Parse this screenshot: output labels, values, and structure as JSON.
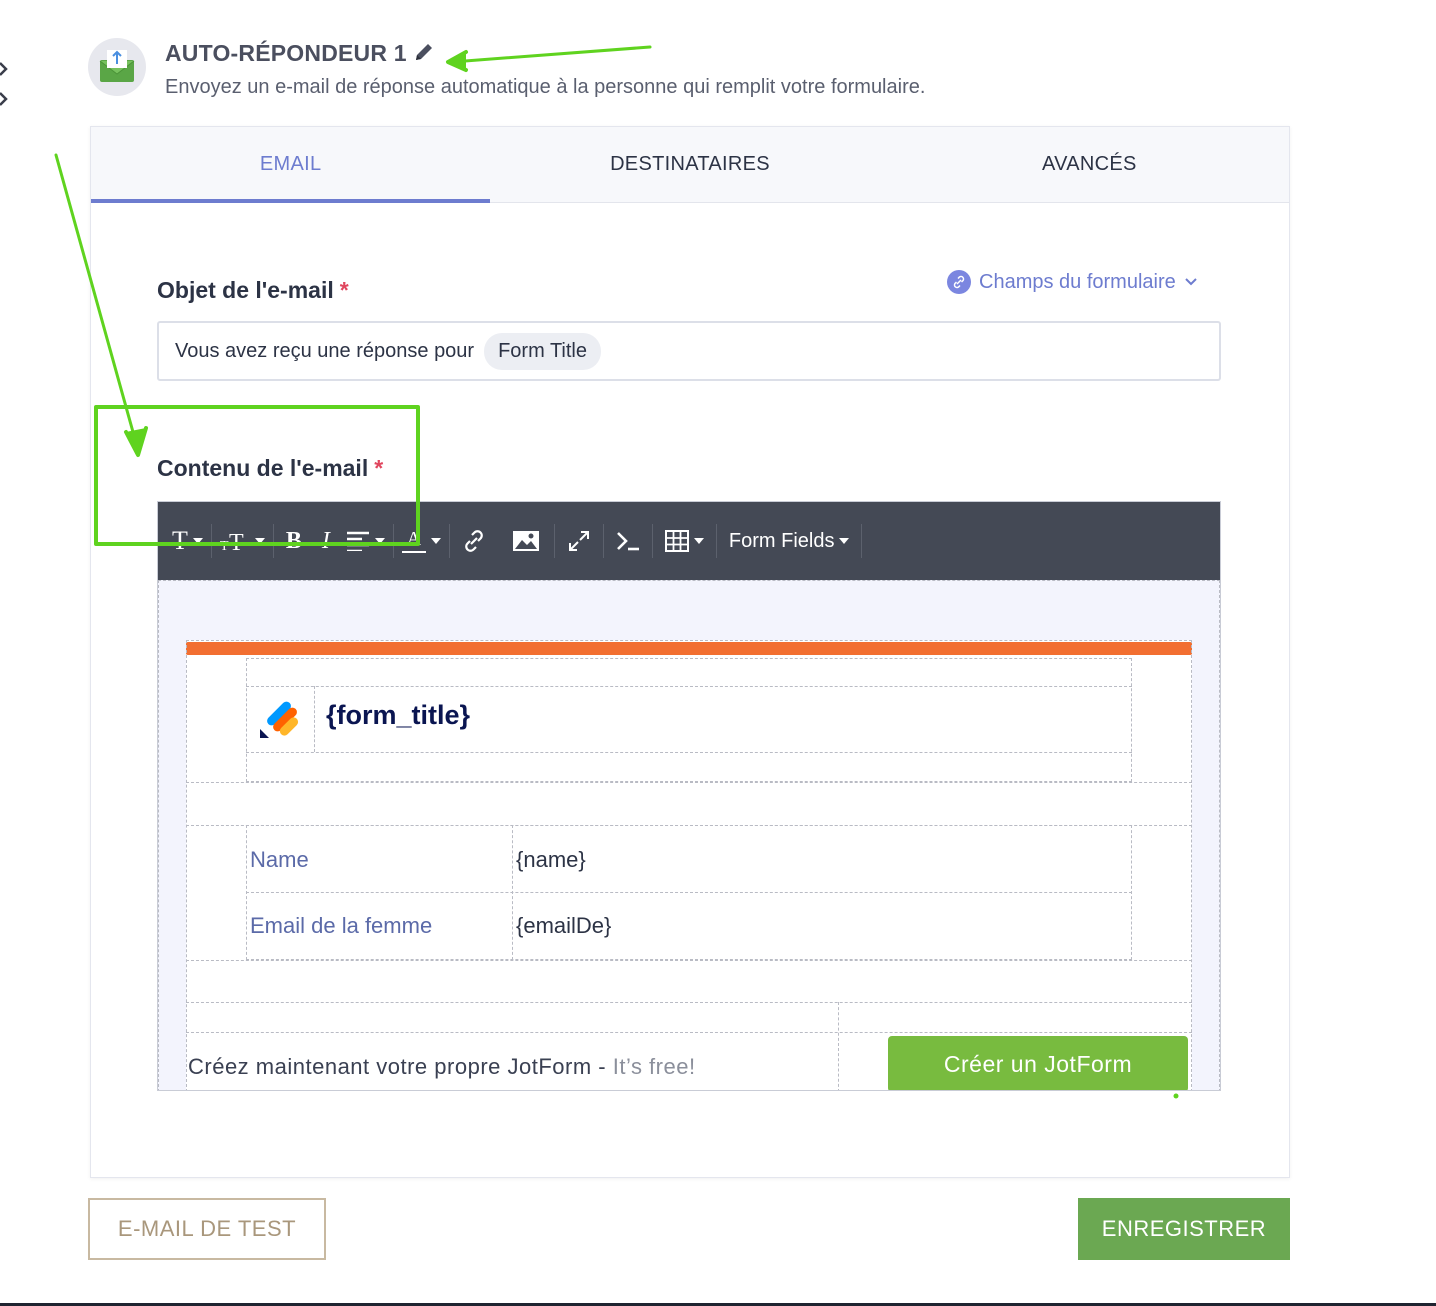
{
  "header": {
    "title": "AUTO-RÉPONDEUR 1",
    "description": "Envoyez un e-mail de réponse automatique à la personne qui remplit votre formulaire."
  },
  "tabs": [
    {
      "label": "EMAIL",
      "active": true
    },
    {
      "label": "DESTINATAIRES",
      "active": false
    },
    {
      "label": "AVANCÉS",
      "active": false
    }
  ],
  "subject": {
    "label": "Objet de l'e-mail",
    "required_mark": "*",
    "value_text": "Vous avez reçu une réponse pour",
    "value_tag": "Form Title"
  },
  "fields_link": {
    "label": "Champs du formulaire"
  },
  "content": {
    "label": "Contenu de l'e-mail",
    "required_mark": "*"
  },
  "toolbar": {
    "form_fields_label": "Form Fields",
    "font_color_glyph": "A"
  },
  "email_template": {
    "title_var": "{form_title}",
    "rows": [
      {
        "label": "Name",
        "value": "{name}"
      },
      {
        "label": "Email de la femme",
        "value": "{emailDe}"
      }
    ],
    "footer_text": "Créez maintenant votre propre JotForm -",
    "footer_free": "It’s free!",
    "create_button": "Créer un JotForm"
  },
  "buttons": {
    "test_email": "E-MAIL DE TEST",
    "save": "ENREGISTRER"
  },
  "colors": {
    "accent": "#6d7ccf",
    "orange_bar": "#f26f31",
    "create_button": "#78bb3f",
    "save_button": "#6ba852",
    "annotation": "#5fd31f",
    "toolbar": "#444955"
  }
}
